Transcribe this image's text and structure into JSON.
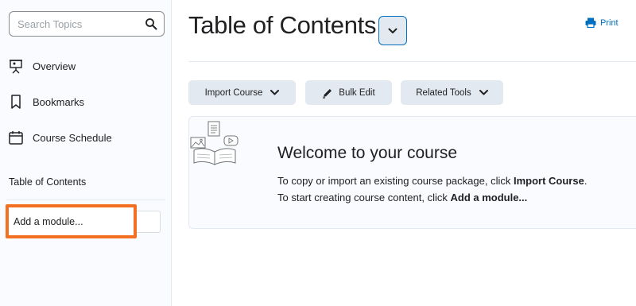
{
  "sidebar": {
    "search": {
      "placeholder": "Search Topics",
      "value": ""
    },
    "nav": [
      {
        "label": "Overview",
        "icon": "presentation-icon"
      },
      {
        "label": "Bookmarks",
        "icon": "bookmark-icon"
      },
      {
        "label": "Course Schedule",
        "icon": "calendar-icon"
      }
    ],
    "toc_label": "Table of Contents",
    "add_module": {
      "placeholder": "Add a module...",
      "value": ""
    }
  },
  "main": {
    "title": "Table of Contents",
    "print_label": "Print",
    "toolbar": {
      "import_course": "Import Course",
      "bulk_edit": "Bulk Edit",
      "related_tools": "Related Tools"
    },
    "welcome": {
      "heading": "Welcome to your course",
      "line1_prefix": "To copy or import an existing course package, click ",
      "line1_bold": "Import Course",
      "line1_suffix": ".",
      "line2_prefix": "To start creating course content, click ",
      "line2_bold": "Add a module..."
    }
  },
  "colors": {
    "accent": "#006fbf",
    "highlight": "#f36f21",
    "sidebar_bg": "#f9fbff",
    "button_bg": "#e3e9f1"
  }
}
